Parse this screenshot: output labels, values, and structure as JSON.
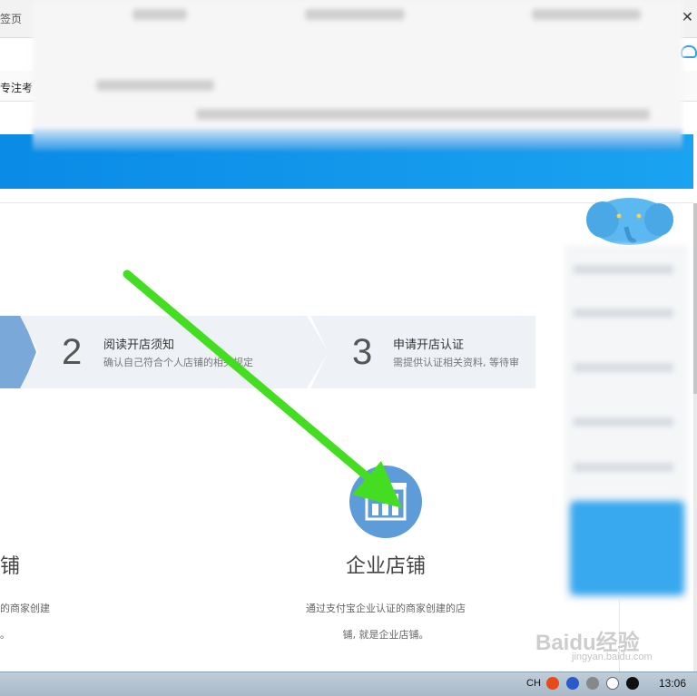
{
  "browser": {
    "tab_label": "签页",
    "close_symbol": "✕",
    "bookmark_label": "专注考",
    "cloud_icon": "cloud-icon"
  },
  "steps": [
    {
      "number": "",
      "title": "",
      "desc": ""
    },
    {
      "number": "2",
      "title": "阅读开店须知",
      "desc": "确认自己符合个人店铺的相关规定"
    },
    {
      "number": "3",
      "title": "申请开店认证",
      "desc": "需提供认证相关资料, 等待审"
    }
  ],
  "shops": {
    "left": {
      "title": "铺",
      "desc_line1": "的商家创建",
      "desc_line2": "。"
    },
    "enterprise": {
      "title": "企业店铺",
      "desc_line1": "通过支付宝企业认证的商家创建的店",
      "desc_line2": "铺, 就是企业店铺。",
      "icon": "building-icon",
      "icon_color": "#5d9cd8"
    }
  },
  "annotation": {
    "arrow_color": "#44dd22"
  },
  "colors": {
    "brand_blue": "#0a8be6",
    "step_active": "#7aa9d9",
    "step_bg": "#eef2f7"
  },
  "taskbar": {
    "ime": "CH",
    "time": "13:06"
  },
  "watermark": {
    "brand": "Baidu经验",
    "url": "jingyan.baidu.com"
  }
}
